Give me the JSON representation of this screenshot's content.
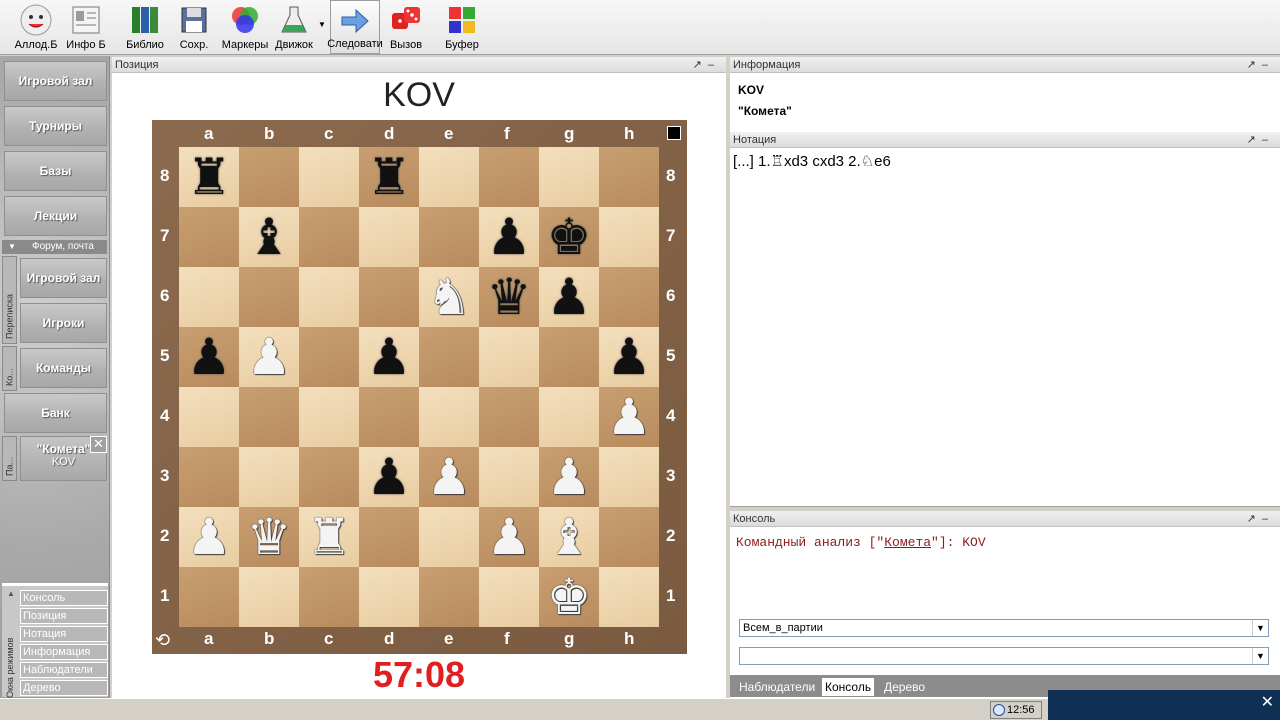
{
  "toolbar": {
    "buttons": [
      {
        "label": "Аллод.Б",
        "icon": "smiley-icon"
      },
      {
        "label": "Инфо Б",
        "icon": "info-card-icon"
      },
      {
        "label": "Библио",
        "icon": "books-icon"
      },
      {
        "label": "Сохр.",
        "icon": "floppy-icon"
      },
      {
        "label": "Маркеры",
        "icon": "markers-icon"
      },
      {
        "label": "Движок",
        "icon": "flask-icon"
      },
      {
        "label": "Следовати",
        "icon": "arrow-right-icon"
      },
      {
        "label": "Вызов",
        "icon": "dice-icon"
      },
      {
        "label": "Буфер",
        "icon": "puzzle-icon"
      }
    ]
  },
  "sidebar": {
    "main": [
      "Игровой зал",
      "Турниры",
      "Базы",
      "Лекции"
    ],
    "forum_header": "Форум, почта",
    "sub": [
      "Игровой зал",
      "Игроки",
      "Команды",
      "Банк"
    ],
    "vtab_correspondence": "Переписка",
    "vtab_ko": "Ко...",
    "vtab_pa": "Па...",
    "game_tab": {
      "line1": "\"Комета\"",
      "line2": "KOV"
    },
    "modes_vtab": "Окна режимов",
    "modes": [
      "Консоль",
      "Позиция",
      "Нотация",
      "Информация",
      "Наблюдатели",
      "Дерево"
    ]
  },
  "position": {
    "title": "Позиция",
    "board_title": "KOV",
    "clock": "57:08",
    "files": [
      "a",
      "b",
      "c",
      "d",
      "e",
      "f",
      "g",
      "h"
    ],
    "ranks": [
      "8",
      "7",
      "6",
      "5",
      "4",
      "3",
      "2",
      "1"
    ],
    "pieces": [
      {
        "sq": "a8",
        "p": "♜",
        "c": "b"
      },
      {
        "sq": "d8",
        "p": "♜",
        "c": "b"
      },
      {
        "sq": "b7",
        "p": "♝",
        "c": "b"
      },
      {
        "sq": "f7",
        "p": "♟",
        "c": "b"
      },
      {
        "sq": "g7",
        "p": "♚",
        "c": "b"
      },
      {
        "sq": "e6",
        "p": "♞",
        "c": "w"
      },
      {
        "sq": "f6",
        "p": "♛",
        "c": "b"
      },
      {
        "sq": "g6",
        "p": "♟",
        "c": "b"
      },
      {
        "sq": "a5",
        "p": "♟",
        "c": "b"
      },
      {
        "sq": "b5",
        "p": "♟",
        "c": "w"
      },
      {
        "sq": "d5",
        "p": "♟",
        "c": "b"
      },
      {
        "sq": "h5",
        "p": "♟",
        "c": "b"
      },
      {
        "sq": "h4",
        "p": "♟",
        "c": "w"
      },
      {
        "sq": "d3",
        "p": "♟",
        "c": "b"
      },
      {
        "sq": "e3",
        "p": "♟",
        "c": "w"
      },
      {
        "sq": "g3",
        "p": "♟",
        "c": "w"
      },
      {
        "sq": "a2",
        "p": "♟",
        "c": "w"
      },
      {
        "sq": "b2",
        "p": "♛",
        "c": "w"
      },
      {
        "sq": "c2",
        "p": "♜",
        "c": "w"
      },
      {
        "sq": "f2",
        "p": "♟",
        "c": "w"
      },
      {
        "sq": "g2",
        "p": "♝",
        "c": "w"
      },
      {
        "sq": "g1",
        "p": "♚",
        "c": "w"
      }
    ]
  },
  "info": {
    "title": "Информация",
    "line1": "KOV",
    "line2": "\"Комета\""
  },
  "notation": {
    "title": "Нотация",
    "text": "[...] 1.♖xd3 cxd3 2.♘e6"
  },
  "console": {
    "title": "Консоль",
    "msg_prefix": "Командный анализ [\"",
    "msg_link": "Комета",
    "msg_suffix": "\"]: KOV",
    "select1": "Всем_в_партии",
    "select2": "",
    "tabs": [
      "Наблюдатели",
      "Консоль",
      "Дерево"
    ]
  },
  "status": {
    "time": "12:56"
  },
  "colors": {
    "clock": "#e02020",
    "console_text": "#8b1a1a"
  }
}
